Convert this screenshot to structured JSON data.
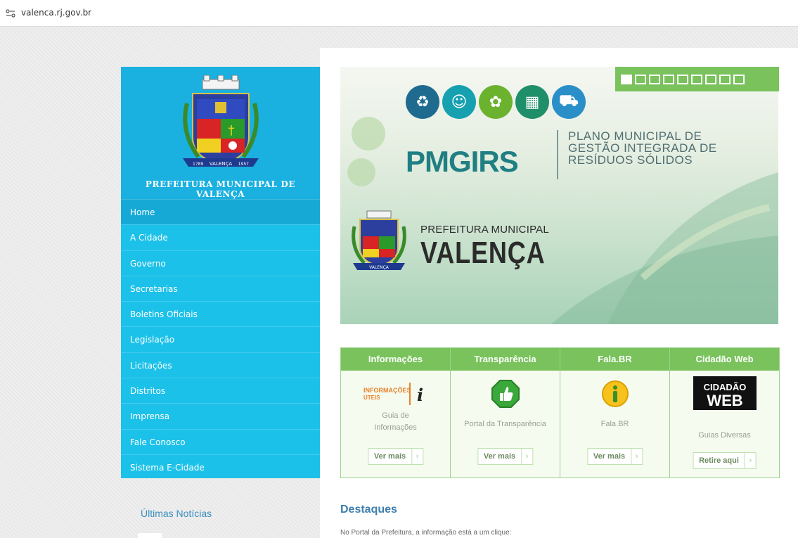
{
  "browser": {
    "url": "valenca.rj.gov.br",
    "site_icon": "site-settings-icon"
  },
  "sidebar": {
    "crest_icon": "municipal-crest-icon",
    "crest_scroll_left": "1789",
    "crest_scroll_center": "VALENÇA",
    "crest_scroll_right": "1957",
    "org_name": "PREFEITURA MUNICIPAL DE VALENÇA",
    "menu": [
      {
        "label": "Home"
      },
      {
        "label": "A Cidade"
      },
      {
        "label": "Governo"
      },
      {
        "label": "Secretarias"
      },
      {
        "label": "Boletins Oficiais"
      },
      {
        "label": "Legislação"
      },
      {
        "label": "Licitações"
      },
      {
        "label": "Distritos"
      },
      {
        "label": "Imprensa"
      },
      {
        "label": "Fale Conosco"
      },
      {
        "label": "Sistema E-Cidade"
      }
    ],
    "news_title": "Últimas Notícias"
  },
  "banner": {
    "acronym": "PMGIRS",
    "plan_line1": "PLANO MUNICIPAL DE",
    "plan_line2": "GESTÃO INTEGRADA DE",
    "plan_line3": "RESÍDUOS SÓLIDOS",
    "pref_small": "PREFEITURA MUNICIPAL",
    "pref_big": "VALENÇA",
    "crest_scroll": "VALENÇA",
    "icons": [
      "recycle-icon",
      "people-icon",
      "plant-icon",
      "building-icon",
      "truck-icon"
    ],
    "slide_count": 9,
    "active_slide": 1
  },
  "services": [
    {
      "title": "Informações",
      "icon": "info-uteis-logo",
      "logo_text1": "INFORMAÇÕES",
      "logo_text2": "ÚTEIS",
      "logo_glyph": "i",
      "desc": "Guia de Informações",
      "button": "Ver mais"
    },
    {
      "title": "Transparência",
      "icon": "thumbs-up-icon",
      "desc": "Portal da Transparência",
      "button": "Ver mais"
    },
    {
      "title": "Fala.BR",
      "icon": "info-icon",
      "desc": "Fala.BR",
      "button": "Ver mais"
    },
    {
      "title": "Cidadão Web",
      "icon": "cidadao-web-logo",
      "logo_text1": "CIDADÃO",
      "logo_text2": "WEB",
      "desc": "Guias Diversas",
      "button": "Retire aqui"
    }
  ],
  "destaques": {
    "title": "Destaques",
    "text": "No Portal da Prefeitura, a informação está a um clique:"
  },
  "colors": {
    "sidebar": "#1cc1e9",
    "menu_active": "#16a9d6",
    "green_accent": "#79c25c",
    "heading_blue": "#3e7fae"
  }
}
